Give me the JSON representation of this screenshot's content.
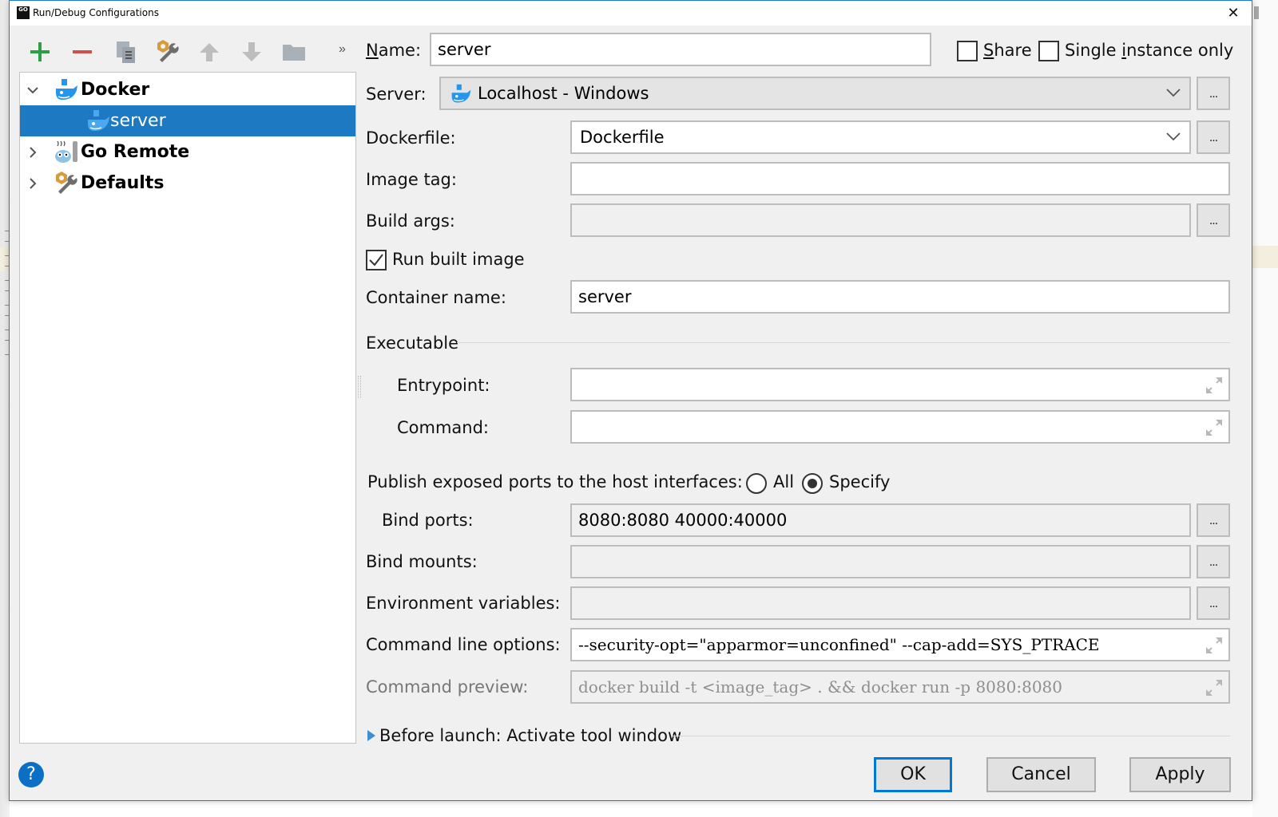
{
  "window": {
    "title": "Run/Debug Configurations",
    "app_icon_text": "GO",
    "close_glyph": "✕"
  },
  "toolbar": {
    "buttons": [
      {
        "name": "add",
        "icon": "plus-icon",
        "color": "#2e9e44"
      },
      {
        "name": "remove",
        "icon": "minus-icon",
        "color": "#d9534f"
      },
      {
        "name": "copy",
        "icon": "copy-icon"
      },
      {
        "name": "edit-defaults",
        "icon": "wrench-icon"
      },
      {
        "name": "move-up",
        "icon": "arrow-up-icon"
      },
      {
        "name": "move-down",
        "icon": "arrow-down-icon"
      },
      {
        "name": "folder",
        "icon": "folder-icon"
      }
    ],
    "more_glyph": "»"
  },
  "tree": {
    "items": [
      {
        "label": "Docker",
        "icon": "docker-icon",
        "expanded": true,
        "bold": true,
        "level": 0
      },
      {
        "label": "server",
        "icon": "docker-icon",
        "selected": true,
        "bold": false,
        "level": 1
      },
      {
        "label": "Go Remote",
        "icon": "go-remote-icon",
        "expanded": false,
        "bold": true,
        "level": 0
      },
      {
        "label": "Defaults",
        "icon": "wrench-icon",
        "expanded": false,
        "bold": true,
        "level": 0
      }
    ]
  },
  "form": {
    "name": {
      "label_mnemonic": "N",
      "label_rest": "ame:",
      "value": "server"
    },
    "share": {
      "label_mnemonic": "S",
      "label_rest": "hare",
      "checked": false
    },
    "single_instance": {
      "label_pre": "Single ",
      "label_mnemonic": "i",
      "label_rest": "nstance only",
      "checked": false
    },
    "server": {
      "label": "Server:",
      "value": "Localhost - Windows",
      "dots": "..."
    },
    "dockerfile": {
      "label": "Dockerfile:",
      "value": "Dockerfile",
      "dots": "..."
    },
    "image_tag": {
      "label": "Image tag:",
      "value": ""
    },
    "build_args": {
      "label": "Build args:",
      "value": "",
      "dots": "..."
    },
    "run_built_image": {
      "label": "Run built image",
      "checked": true
    },
    "container_name": {
      "label": "Container name:",
      "value": "server"
    },
    "executable": {
      "section_label": "Executable",
      "entrypoint": {
        "label": "Entrypoint:",
        "value": ""
      },
      "command": {
        "label": "Command:",
        "value": ""
      }
    },
    "publish_ports": {
      "label": "Publish exposed ports to the host interfaces:",
      "options": [
        {
          "label": "All",
          "checked": false
        },
        {
          "label": "Specify",
          "checked": true
        }
      ]
    },
    "bind_ports": {
      "label": "Bind ports:",
      "value": "8080:8080 40000:40000",
      "dots": "..."
    },
    "bind_mounts": {
      "label": "Bind mounts:",
      "value": "",
      "dots": "..."
    },
    "env_vars": {
      "label": "Environment variables:",
      "value": "",
      "dots": "..."
    },
    "cmd_options": {
      "label": "Command line options:",
      "value": "--security-opt=\"apparmor=unconfined\" --cap-add=SYS_PTRACE"
    },
    "cmd_preview": {
      "label": "Command preview:",
      "value": "docker build -t <image_tag> . && docker run -p 8080:8080"
    },
    "before_launch": {
      "label": "Before launch: Activate tool window"
    }
  },
  "footer": {
    "help_glyph": "?",
    "ok": "OK",
    "cancel": "Cancel",
    "apply": "Apply"
  },
  "colors": {
    "accent": "#0078d7",
    "selection": "#1d7ac2",
    "docker_blue": "#2496ed"
  }
}
